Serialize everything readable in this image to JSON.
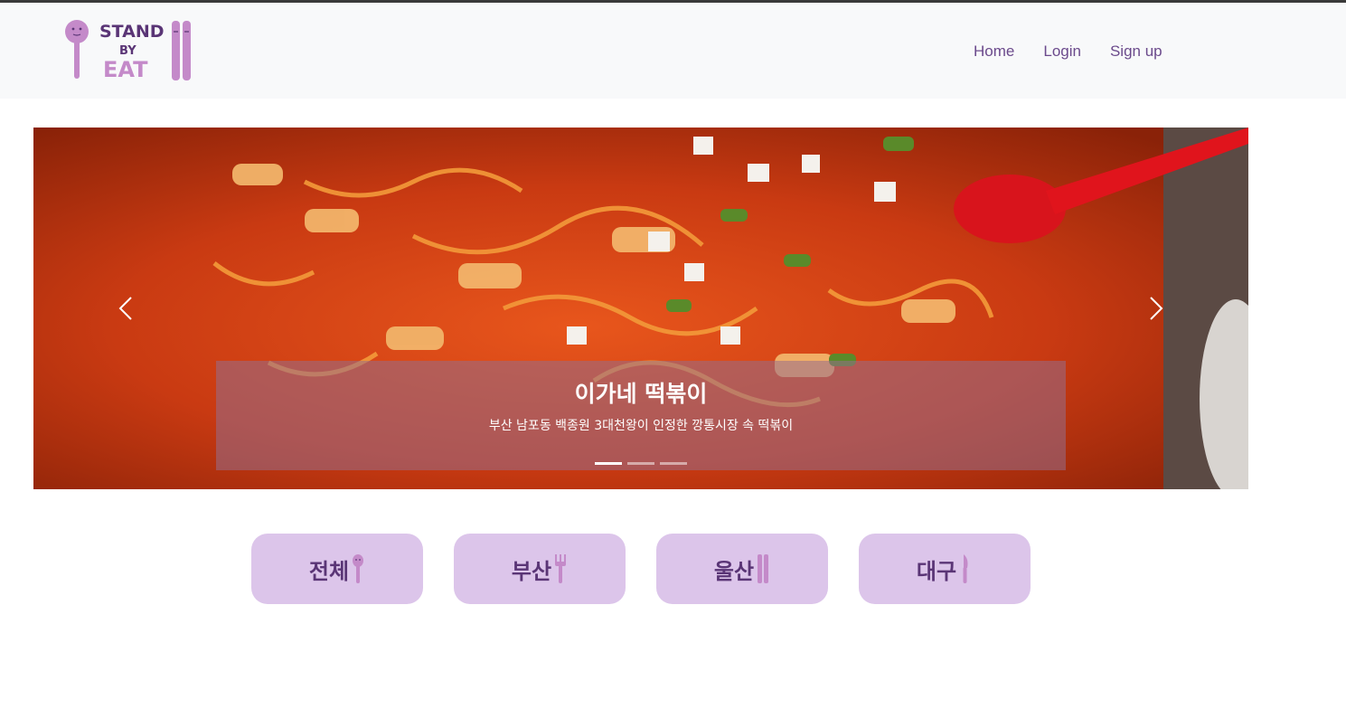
{
  "nav": {
    "logo_text": [
      "STAND",
      "BY",
      "EAT"
    ],
    "links": [
      "Home",
      "Login",
      "Sign up"
    ]
  },
  "carousel": {
    "slide_title": "이가네 떡볶이",
    "slide_subtitle": "부산 남포동 백종원 3대천왕이 인정한 깡통시장 속 떡볶이",
    "slide_count": 3,
    "active_slide": 1,
    "colors": {
      "caption_bg": "#966e8c"
    }
  },
  "regions": [
    {
      "label": "전체",
      "icon": "spoon-icon"
    },
    {
      "label": "부산",
      "icon": "fork-icon"
    },
    {
      "label": "울산",
      "icon": "chopsticks-icon"
    },
    {
      "label": "대구",
      "icon": "knife-icon"
    }
  ],
  "colors": {
    "accent": "#c48ac9",
    "nav_text": "#6b4a8c",
    "region_bg": "#dcc5ea",
    "region_text": "#5a3576"
  }
}
